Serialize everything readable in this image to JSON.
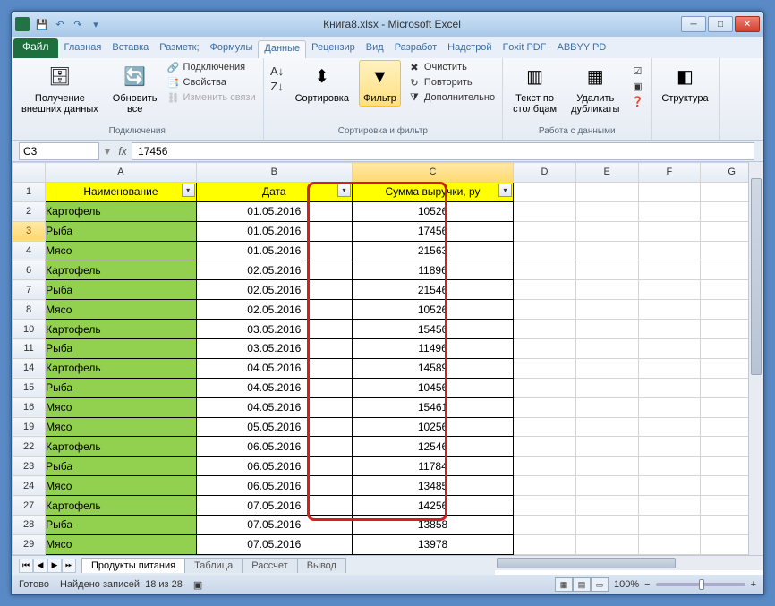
{
  "title": "Книга8.xlsx - Microsoft Excel",
  "qat": {
    "save": "💾",
    "undo": "↶",
    "redo": "↷"
  },
  "tabs": {
    "file": "Файл",
    "items": [
      "Главная",
      "Вставка",
      "Разметк;",
      "Формулы",
      "Данные",
      "Рецензир",
      "Вид",
      "Разработ",
      "Надстрой",
      "Foxit PDF",
      "ABBYY PD"
    ],
    "active_index": 4
  },
  "ribbon": {
    "g_connections": {
      "get_external": "Получение\nвнешних данных",
      "refresh_all": "Обновить\nвсе",
      "connections": "Подключения",
      "properties": "Свойства",
      "edit_links": "Изменить связи",
      "label": "Подключения"
    },
    "g_sort": {
      "sort": "Сортировка",
      "filter": "Фильтр",
      "clear": "Очистить",
      "reapply": "Повторить",
      "advanced": "Дополнительно",
      "label": "Сортировка и фильтр"
    },
    "g_data": {
      "text_to_columns": "Текст по\nстолбцам",
      "remove_dups": "Удалить\nдубликаты",
      "label": "Работа с данными"
    },
    "g_outline": {
      "structure": "Структура",
      "label": ""
    }
  },
  "name_box": "C3",
  "fx": "fx",
  "formula_value": "17456",
  "col_headers": [
    "",
    "A",
    "B",
    "C",
    "D",
    "E",
    "F",
    "G"
  ],
  "headers": {
    "a": "Наименование",
    "b": "Дата",
    "c": "Сумма выручки, ру"
  },
  "rows": [
    {
      "n": "2",
      "a": "Картофель",
      "b": "01.05.2016",
      "c": "10526"
    },
    {
      "n": "3",
      "a": "Рыба",
      "b": "01.05.2016",
      "c": "17456"
    },
    {
      "n": "4",
      "a": "Мясо",
      "b": "01.05.2016",
      "c": "21563"
    },
    {
      "n": "6",
      "a": "Картофель",
      "b": "02.05.2016",
      "c": "11896"
    },
    {
      "n": "7",
      "a": "Рыба",
      "b": "02.05.2016",
      "c": "21546"
    },
    {
      "n": "8",
      "a": "Мясо",
      "b": "02.05.2016",
      "c": "10526"
    },
    {
      "n": "10",
      "a": "Картофель",
      "b": "03.05.2016",
      "c": "15456"
    },
    {
      "n": "11",
      "a": "Рыба",
      "b": "03.05.2016",
      "c": "11496"
    },
    {
      "n": "14",
      "a": "Картофель",
      "b": "04.05.2016",
      "c": "14589"
    },
    {
      "n": "15",
      "a": "Рыба",
      "b": "04.05.2016",
      "c": "10456"
    },
    {
      "n": "16",
      "a": "Мясо",
      "b": "04.05.2016",
      "c": "15461"
    },
    {
      "n": "19",
      "a": "Мясо",
      "b": "05.05.2016",
      "c": "10256"
    },
    {
      "n": "22",
      "a": "Картофель",
      "b": "06.05.2016",
      "c": "12546"
    },
    {
      "n": "23",
      "a": "Рыба",
      "b": "06.05.2016",
      "c": "11784"
    },
    {
      "n": "24",
      "a": "Мясо",
      "b": "06.05.2016",
      "c": "13485"
    },
    {
      "n": "27",
      "a": "Картофель",
      "b": "07.05.2016",
      "c": "14256"
    },
    {
      "n": "28",
      "a": "Рыба",
      "b": "07.05.2016",
      "c": "13858"
    },
    {
      "n": "29",
      "a": "Мясо",
      "b": "07.05.2016",
      "c": "13978"
    }
  ],
  "selected_row_index": 1,
  "sheets": [
    "Продукты питания",
    "Таблица",
    "Рассчет",
    "Вывод"
  ],
  "active_sheet": 0,
  "status": {
    "ready": "Готово",
    "found": "Найдено записей: 18 из 28",
    "zoom": "100%",
    "zoom_minus": "−",
    "zoom_plus": "+"
  }
}
